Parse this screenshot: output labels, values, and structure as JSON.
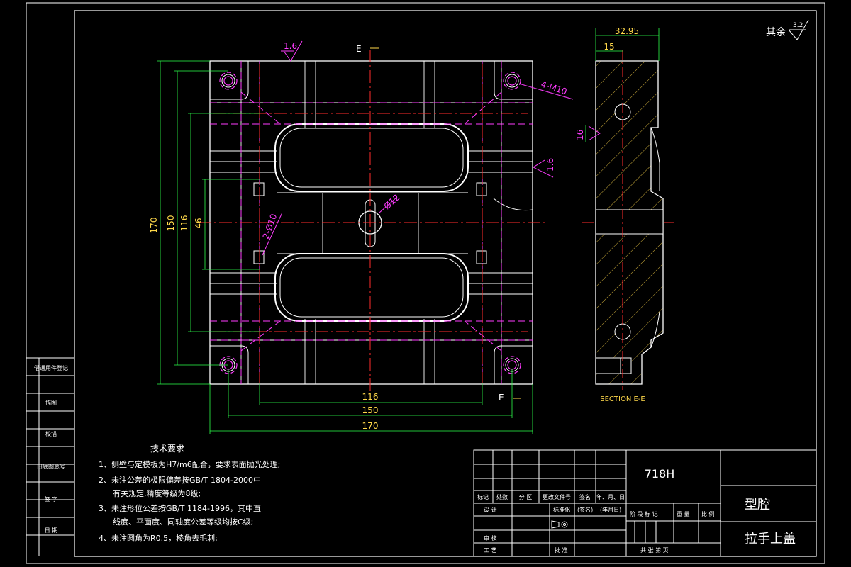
{
  "surface_finish": {
    "label": "其余",
    "value": "3.2"
  },
  "dims": {
    "side_width": "32.95",
    "side_inner": "15",
    "side_hole": "16",
    "height_170": "170",
    "height_150": "150",
    "height_116": "116",
    "height_46": "46",
    "width_116": "116",
    "width_150": "150",
    "width_170": "170",
    "finish_top": "1.6",
    "finish_right": "1.6",
    "hole_center": "Ø12",
    "hole_side": "2-Ø10",
    "thread": "4-M10"
  },
  "section": {
    "marker": "E",
    "marker_top": "E",
    "marker_bottom": "E",
    "caption": "SECTION E-E"
  },
  "left_strip": [
    "借通用件登记",
    "描图",
    "校描",
    "旧底图总号",
    "签 字",
    "日 期"
  ],
  "notes": {
    "heading": "技术要求",
    "lines": [
      "1、侧壁与定模板为H7/m6配合，要求表面抛光处理;",
      "2、未注公差的极限偏差按GB/T 1804-2000中",
      "有关规定,精度等级为8级;",
      "3、未注形位公差按GB/T 1184-1996，其中直",
      "线度、平面度、同轴度公差等级均按C级;",
      "4、未注圆角为R0.5，棱角去毛刺;"
    ]
  },
  "title_block": {
    "material": "718H",
    "name_top": "型腔",
    "name_bottom": "拉手上盖",
    "header_row": [
      "标记",
      "处数",
      "分 区",
      "更改文件号",
      "签名",
      "年、月、日"
    ],
    "design": "设 计",
    "standardize": "标准化",
    "sign": "(签名)",
    "date": "(年月日)",
    "stage_labels": [
      "阶 段 标 记",
      "重 量",
      "比 例"
    ],
    "review": "审 核",
    "process": "工 艺",
    "approve": "批 准",
    "sheets": "共   张   第   页"
  },
  "colors": {
    "frame": "#ffffff",
    "dimension": "#ffd84a",
    "annotation": "#ff3cff",
    "centerline": "#ff2d2d",
    "extension": "#2dff4a"
  }
}
